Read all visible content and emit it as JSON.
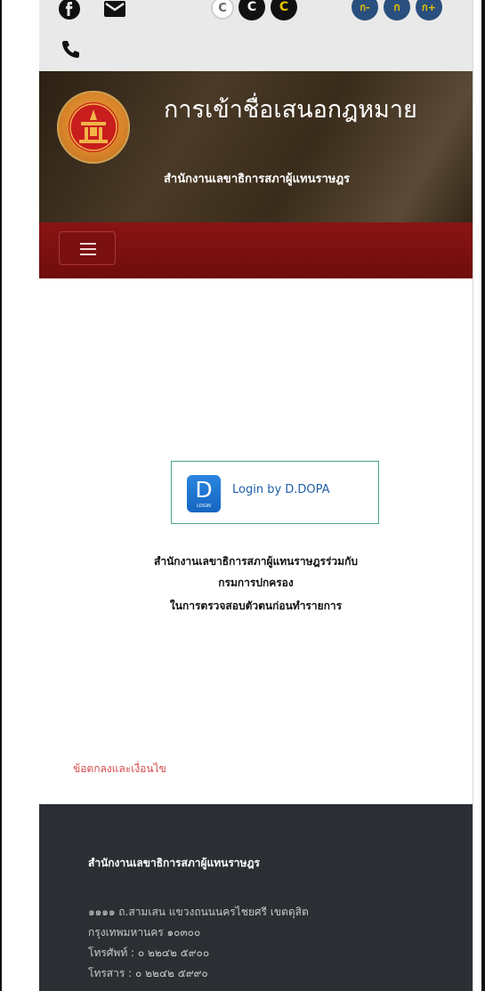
{
  "topbar": {
    "icons": [
      "facebook-icon",
      "email-icon",
      "phone-icon",
      "contrast-normal-icon",
      "contrast-black-icon",
      "contrast-yellow-icon",
      "font-decrease-icon",
      "font-normal-icon",
      "font-increase-icon"
    ],
    "contrast_labels": [
      "C",
      "C",
      "C"
    ],
    "font_labels": [
      "ก-",
      "ก",
      "ก+"
    ]
  },
  "header": {
    "title": "การเข้าชื่อเสนอกฎหมาย",
    "subtitle": "สำนักงานเลขาธิการสภาผู้แทนราษฎร"
  },
  "login": {
    "logo_letter": "D",
    "logo_small": "LOGIN",
    "label": "Login by D.DOPA"
  },
  "description": {
    "line1": "สำนักงานเลขาธิการสภาผู้แทนราษฎรร่วมกับ",
    "line2": "กรมการปกครอง",
    "line3": "ในการตรวจสอบตัวตนก่อนทำรายการ"
  },
  "terms_link": "ข้อตกลงและเงื่อนไข",
  "footer": {
    "title": "สำนักงานเลขาธิการสภาผู้แทนราษฎร",
    "address1": "๑๑๑๑ ถ.สามเสน แขวงถนนนครไชยศรี เขตดุสิต",
    "address2": "กรุงเทพมหานคร ๑๐๓๐๐",
    "phone": "โทรศัพท์ : ๐ ๒๒๔๒ ๕๙๐๐",
    "fax": "โทรสาร : ๐ ๒๒๔๒ ๕๙๙๐"
  },
  "colors": {
    "topbar_bg": "#e9e9e9",
    "nav_red": "#7a1010",
    "footer_bg": "#2b2f33",
    "link_red": "#d44a4a",
    "font_button_blue": "#2a4f7e",
    "login_border": "#4aa67a"
  }
}
